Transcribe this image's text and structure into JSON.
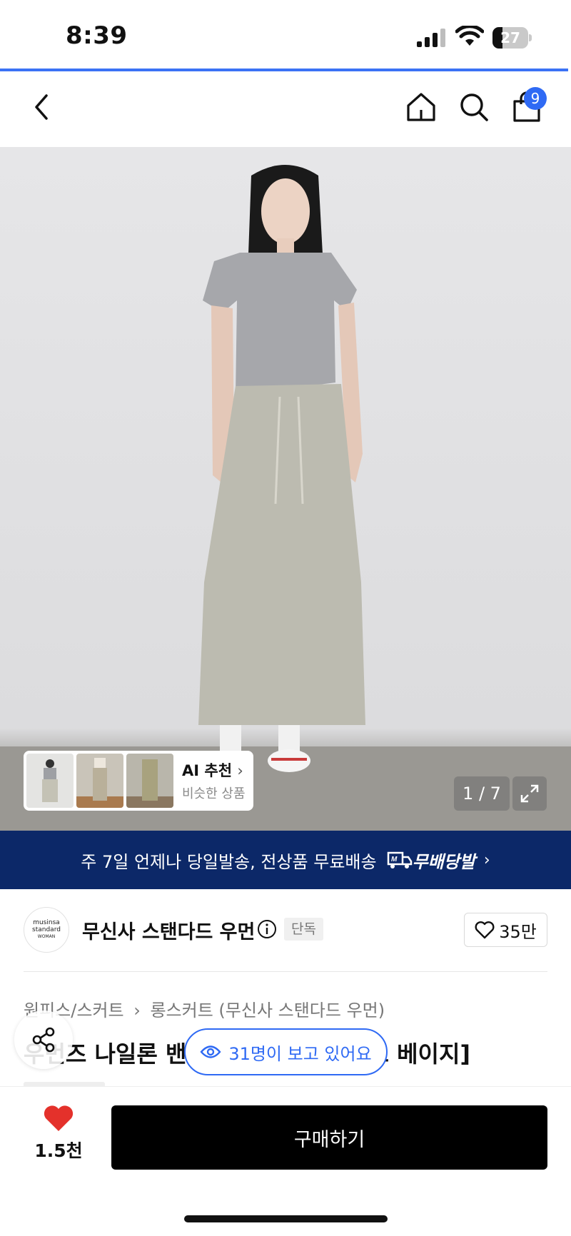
{
  "status_bar": {
    "time": "8:39",
    "battery": "27",
    "battery_level": 0.27
  },
  "header": {
    "cart_badge": "9"
  },
  "gallery": {
    "ai_title": "AI 추천",
    "ai_subtitle": "비슷한 상품",
    "counter": "1 / 7"
  },
  "delivery": {
    "text": "주 7일 언제나 당일발송, 전상품 무료배송",
    "logo_text": "무배당발"
  },
  "brand": {
    "name": "무신사 스탠다드 우먼",
    "logo_lines": [
      "musinsa",
      "standard",
      "WOMAN"
    ],
    "tag": "단독",
    "likes": "35만"
  },
  "breadcrumb": {
    "category": "원피스/스커트",
    "subcategory": "롱스커트 (무신사 스탠다드 우먼)"
  },
  "product": {
    "title": "우먼즈 나일론 밴딩 롱 스커트 [라이트 베이지]"
  },
  "viewers": {
    "text": "31명이 보고 있어요"
  },
  "bottom_bar": {
    "wish_count": "1.5천",
    "buy_label": "구매하기"
  },
  "colors": {
    "accent": "#2f6af4",
    "banner": "#0c2868",
    "heart": "#e4312b"
  }
}
